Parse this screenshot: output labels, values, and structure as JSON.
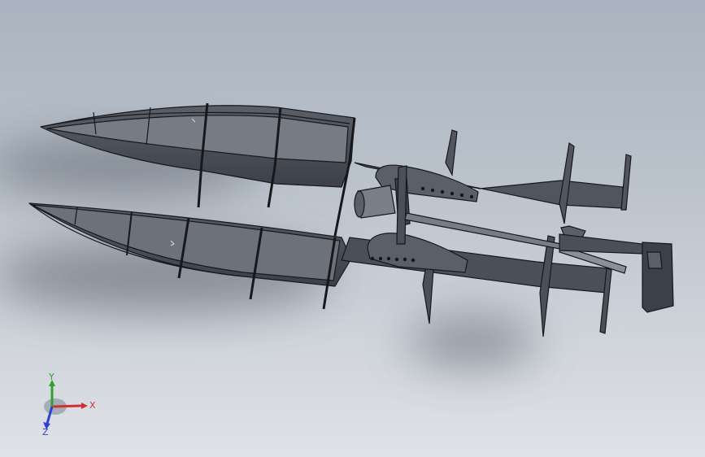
{
  "viewport": {
    "background_top": "#aab4c0",
    "background_bottom": "#dfe2e6",
    "model_color": "#4b4f57",
    "model_edge": "#16181c"
  },
  "triad": {
    "x_label": "X",
    "y_label": "Y",
    "z_label": "Z",
    "x_color": "#d03030",
    "y_color": "#30a030",
    "z_color": "#3040d0"
  }
}
